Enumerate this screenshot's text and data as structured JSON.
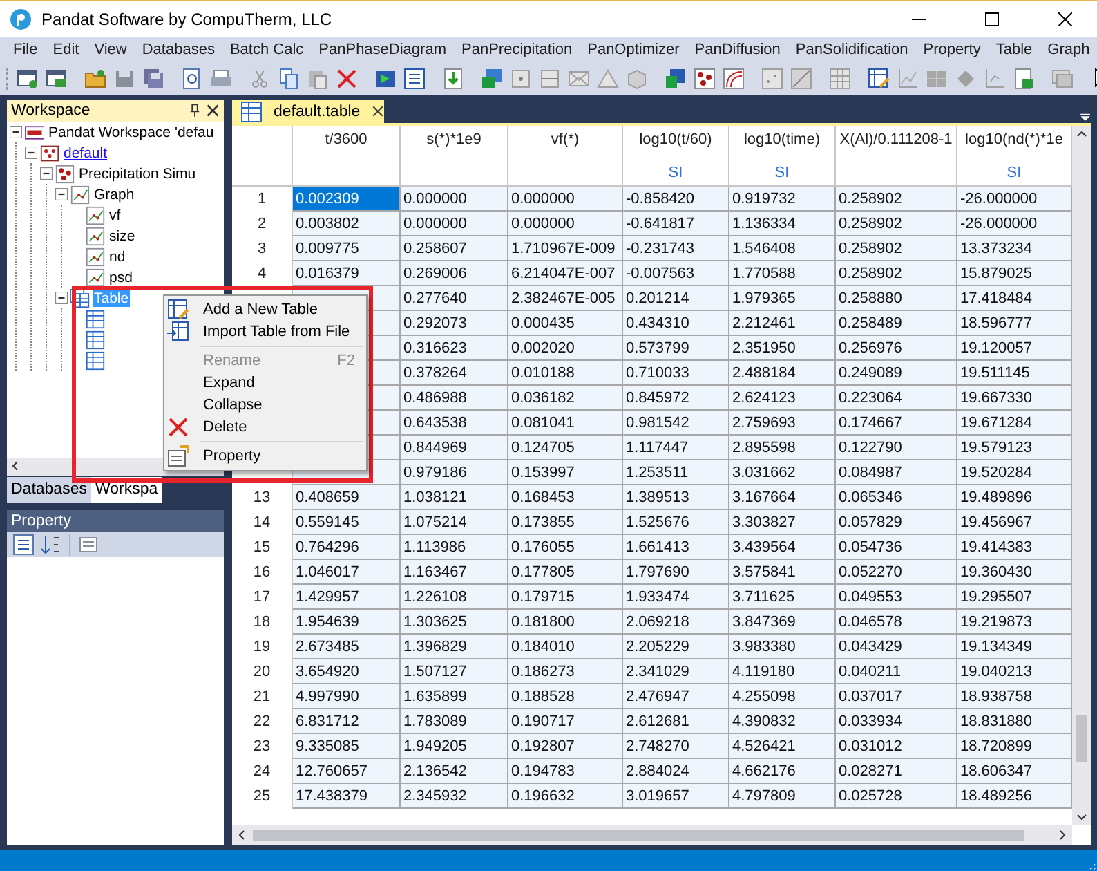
{
  "window": {
    "title": "Pandat Software by CompuTherm, LLC"
  },
  "menu_bar": [
    "File",
    "Edit",
    "View",
    "Databases",
    "Batch Calc",
    "PanPhaseDiagram",
    "PanPrecipitation",
    "PanOptimizer",
    "PanDiffusion",
    "PanSolidification",
    "Property",
    "Table",
    "Graph"
  ],
  "workspace_panel": {
    "title": "Workspace",
    "tree": [
      {
        "label": "Pandat Workspace 'defau",
        "kind": "workspace",
        "expanded": true,
        "selected": false,
        "hyperlink": false,
        "children": [
          {
            "label": "default",
            "kind": "database",
            "expanded": true,
            "selected": false,
            "hyperlink": true,
            "children": [
              {
                "label": "Precipitation Simu",
                "kind": "simulation",
                "expanded": true,
                "selected": false,
                "hyperlink": false,
                "children": [
                  {
                    "label": "Graph",
                    "kind": "graph",
                    "expanded": true,
                    "selected": false,
                    "hyperlink": false,
                    "children": [
                      {
                        "label": "vf",
                        "kind": "graph",
                        "selected": false,
                        "hyperlink": false
                      },
                      {
                        "label": "size",
                        "kind": "graph",
                        "selected": false,
                        "hyperlink": false
                      },
                      {
                        "label": "nd",
                        "kind": "graph",
                        "selected": false,
                        "hyperlink": false
                      },
                      {
                        "label": "psd",
                        "kind": "graph",
                        "selected": false,
                        "hyperlink": false
                      }
                    ]
                  },
                  {
                    "label": "Table",
                    "kind": "tables",
                    "expanded": true,
                    "selected": true,
                    "hyperlink": false,
                    "children": [
                      {
                        "kind": "table"
                      },
                      {
                        "kind": "table"
                      },
                      {
                        "kind": "table"
                      }
                    ]
                  }
                ]
              }
            ]
          }
        ]
      }
    ]
  },
  "panel_tabs": [
    {
      "label": "Databases",
      "selected": false
    },
    {
      "label": "Workspa",
      "selected": true
    }
  ],
  "property_panel": {
    "title": "Property"
  },
  "document_tabs": [
    {
      "label": "default.table",
      "selected": true
    }
  ],
  "table": {
    "columns": [
      {
        "name": "t/3600"
      },
      {
        "name": "s(*)*1e9"
      },
      {
        "name": "vf(*)"
      },
      {
        "name": "log10(t/60)",
        "unit": "SI"
      },
      {
        "name": "log10(time)",
        "unit": "SI"
      },
      {
        "name": "X(Al)/0.111208-1"
      },
      {
        "name": "log10(nd(*)*1e",
        "unit": "SI"
      }
    ],
    "rows": [
      {
        "number": "1",
        "cells": [
          {
            "text": "0.002309",
            "selected": true
          },
          {
            "text": "0.000000",
            "selected": false
          },
          {
            "text": "0.000000",
            "selected": false
          },
          {
            "text": "-0.858420",
            "selected": false
          },
          {
            "text": "0.919732",
            "selected": false
          },
          {
            "text": "0.258902",
            "selected": false
          },
          {
            "text": "-26.000000",
            "selected": false
          }
        ]
      },
      {
        "number": "2",
        "cells": [
          {
            "text": "0.003802",
            "selected": false
          },
          {
            "text": "0.000000",
            "selected": false
          },
          {
            "text": "0.000000",
            "selected": false
          },
          {
            "text": "-0.641817",
            "selected": false
          },
          {
            "text": "1.136334",
            "selected": false
          },
          {
            "text": "0.258902",
            "selected": false
          },
          {
            "text": "-26.000000",
            "selected": false
          }
        ]
      },
      {
        "number": "3",
        "cells": [
          {
            "text": "0.009775",
            "selected": false
          },
          {
            "text": "0.258607",
            "selected": false
          },
          {
            "text": "1.710967E-009",
            "selected": false
          },
          {
            "text": "-0.231743",
            "selected": false
          },
          {
            "text": "1.546408",
            "selected": false
          },
          {
            "text": "0.258902",
            "selected": false
          },
          {
            "text": "13.373234",
            "selected": false
          }
        ]
      },
      {
        "number": "4",
        "cells": [
          {
            "text": "0.016379",
            "selected": false
          },
          {
            "text": "0.269006",
            "selected": false
          },
          {
            "text": "6.214047E-007",
            "selected": false
          },
          {
            "text": "-0.007563",
            "selected": false
          },
          {
            "text": "1.770588",
            "selected": false
          },
          {
            "text": "0.258902",
            "selected": false
          },
          {
            "text": "15.879025",
            "selected": false
          }
        ]
      },
      {
        "cells": [
          {
            "selected": false
          },
          {
            "text": "0.277640",
            "selected": false
          },
          {
            "text": "2.382467E-005",
            "selected": false
          },
          {
            "text": "0.201214",
            "selected": false
          },
          {
            "text": "1.979365",
            "selected": false
          },
          {
            "text": "0.258880",
            "selected": false
          },
          {
            "text": "17.418484",
            "selected": false
          }
        ]
      },
      {
        "cells": [
          {
            "selected": false
          },
          {
            "text": "0.292073",
            "selected": false
          },
          {
            "text": "0.000435",
            "selected": false
          },
          {
            "text": "0.434310",
            "selected": false
          },
          {
            "text": "2.212461",
            "selected": false
          },
          {
            "text": "0.258489",
            "selected": false
          },
          {
            "text": "18.596777",
            "selected": false
          }
        ]
      },
      {
        "cells": [
          {
            "selected": false
          },
          {
            "text": "0.316623",
            "selected": false
          },
          {
            "text": "0.002020",
            "selected": false
          },
          {
            "text": "0.573799",
            "selected": false
          },
          {
            "text": "2.351950",
            "selected": false
          },
          {
            "text": "0.256976",
            "selected": false
          },
          {
            "text": "19.120057",
            "selected": false
          }
        ]
      },
      {
        "cells": [
          {
            "selected": false
          },
          {
            "text": "0.378264",
            "selected": false
          },
          {
            "text": "0.010188",
            "selected": false
          },
          {
            "text": "0.710033",
            "selected": false
          },
          {
            "text": "2.488184",
            "selected": false
          },
          {
            "text": "0.249089",
            "selected": false
          },
          {
            "text": "19.511145",
            "selected": false
          }
        ]
      },
      {
        "cells": [
          {
            "selected": false
          },
          {
            "text": "0.486988",
            "selected": false
          },
          {
            "text": "0.036182",
            "selected": false
          },
          {
            "text": "0.845972",
            "selected": false
          },
          {
            "text": "2.624123",
            "selected": false
          },
          {
            "text": "0.223064",
            "selected": false
          },
          {
            "text": "19.667330",
            "selected": false
          }
        ]
      },
      {
        "cells": [
          {
            "selected": false
          },
          {
            "text": "0.643538",
            "selected": false
          },
          {
            "text": "0.081041",
            "selected": false
          },
          {
            "text": "0.981542",
            "selected": false
          },
          {
            "text": "2.759693",
            "selected": false
          },
          {
            "text": "0.174667",
            "selected": false
          },
          {
            "text": "19.671284",
            "selected": false
          }
        ]
      },
      {
        "cells": [
          {
            "selected": false
          },
          {
            "text": "0.844969",
            "selected": false
          },
          {
            "text": "0.124705",
            "selected": false
          },
          {
            "text": "1.117447",
            "selected": false
          },
          {
            "text": "2.895598",
            "selected": false
          },
          {
            "text": "0.122790",
            "selected": false
          },
          {
            "text": "19.579123",
            "selected": false
          }
        ]
      },
      {
        "cells": [
          {
            "selected": false
          },
          {
            "text": "0.979186",
            "selected": false
          },
          {
            "text": "0.153997",
            "selected": false
          },
          {
            "text": "1.253511",
            "selected": false
          },
          {
            "text": "3.031662",
            "selected": false
          },
          {
            "text": "0.084987",
            "selected": false
          },
          {
            "text": "19.520284",
            "selected": false
          }
        ]
      },
      {
        "number": "13",
        "cells": [
          {
            "text": "0.408659",
            "selected": false
          },
          {
            "text": "1.038121",
            "selected": false
          },
          {
            "text": "0.168453",
            "selected": false
          },
          {
            "text": "1.389513",
            "selected": false
          },
          {
            "text": "3.167664",
            "selected": false
          },
          {
            "text": "0.065346",
            "selected": false
          },
          {
            "text": "19.489896",
            "selected": false
          }
        ]
      },
      {
        "number": "14",
        "cells": [
          {
            "text": "0.559145",
            "selected": false
          },
          {
            "text": "1.075214",
            "selected": false
          },
          {
            "text": "0.173855",
            "selected": false
          },
          {
            "text": "1.525676",
            "selected": false
          },
          {
            "text": "3.303827",
            "selected": false
          },
          {
            "text": "0.057829",
            "selected": false
          },
          {
            "text": "19.456967",
            "selected": false
          }
        ]
      },
      {
        "number": "15",
        "cells": [
          {
            "text": "0.764296",
            "selected": false
          },
          {
            "text": "1.113986",
            "selected": false
          },
          {
            "text": "0.176055",
            "selected": false
          },
          {
            "text": "1.661413",
            "selected": false
          },
          {
            "text": "3.439564",
            "selected": false
          },
          {
            "text": "0.054736",
            "selected": false
          },
          {
            "text": "19.414383",
            "selected": false
          }
        ]
      },
      {
        "number": "16",
        "cells": [
          {
            "text": "1.046017",
            "selected": false
          },
          {
            "text": "1.163467",
            "selected": false
          },
          {
            "text": "0.177805",
            "selected": false
          },
          {
            "text": "1.797690",
            "selected": false
          },
          {
            "text": "3.575841",
            "selected": false
          },
          {
            "text": "0.052270",
            "selected": false
          },
          {
            "text": "19.360430",
            "selected": false
          }
        ]
      },
      {
        "number": "17",
        "cells": [
          {
            "text": "1.429957",
            "selected": false
          },
          {
            "text": "1.226108",
            "selected": false
          },
          {
            "text": "0.179715",
            "selected": false
          },
          {
            "text": "1.933474",
            "selected": false
          },
          {
            "text": "3.711625",
            "selected": false
          },
          {
            "text": "0.049553",
            "selected": false
          },
          {
            "text": "19.295507",
            "selected": false
          }
        ]
      },
      {
        "number": "18",
        "cells": [
          {
            "text": "1.954639",
            "selected": false
          },
          {
            "text": "1.303625",
            "selected": false
          },
          {
            "text": "0.181800",
            "selected": false
          },
          {
            "text": "2.069218",
            "selected": false
          },
          {
            "text": "3.847369",
            "selected": false
          },
          {
            "text": "0.046578",
            "selected": false
          },
          {
            "text": "19.219873",
            "selected": false
          }
        ]
      },
      {
        "number": "19",
        "cells": [
          {
            "text": "2.673485",
            "selected": false
          },
          {
            "text": "1.396829",
            "selected": false
          },
          {
            "text": "0.184010",
            "selected": false
          },
          {
            "text": "2.205229",
            "selected": false
          },
          {
            "text": "3.983380",
            "selected": false
          },
          {
            "text": "0.043429",
            "selected": false
          },
          {
            "text": "19.134349",
            "selected": false
          }
        ]
      },
      {
        "number": "20",
        "cells": [
          {
            "text": "3.654920",
            "selected": false
          },
          {
            "text": "1.507127",
            "selected": false
          },
          {
            "text": "0.186273",
            "selected": false
          },
          {
            "text": "2.341029",
            "selected": false
          },
          {
            "text": "4.119180",
            "selected": false
          },
          {
            "text": "0.040211",
            "selected": false
          },
          {
            "text": "19.040213",
            "selected": false
          }
        ]
      },
      {
        "number": "21",
        "cells": [
          {
            "text": "4.997990",
            "selected": false
          },
          {
            "text": "1.635899",
            "selected": false
          },
          {
            "text": "0.188528",
            "selected": false
          },
          {
            "text": "2.476947",
            "selected": false
          },
          {
            "text": "4.255098",
            "selected": false
          },
          {
            "text": "0.037017",
            "selected": false
          },
          {
            "text": "18.938758",
            "selected": false
          }
        ]
      },
      {
        "number": "22",
        "cells": [
          {
            "text": "6.831712",
            "selected": false
          },
          {
            "text": "1.783089",
            "selected": false
          },
          {
            "text": "0.190717",
            "selected": false
          },
          {
            "text": "2.612681",
            "selected": false
          },
          {
            "text": "4.390832",
            "selected": false
          },
          {
            "text": "0.033934",
            "selected": false
          },
          {
            "text": "18.831880",
            "selected": false
          }
        ]
      },
      {
        "number": "23",
        "cells": [
          {
            "text": "9.335085",
            "selected": false
          },
          {
            "text": "1.949205",
            "selected": false
          },
          {
            "text": "0.192807",
            "selected": false
          },
          {
            "text": "2.748270",
            "selected": false
          },
          {
            "text": "4.526421",
            "selected": false
          },
          {
            "text": "0.031012",
            "selected": false
          },
          {
            "text": "18.720899",
            "selected": false
          }
        ]
      },
      {
        "number": "24",
        "cells": [
          {
            "text": "12.760657",
            "selected": false
          },
          {
            "text": "2.136542",
            "selected": false
          },
          {
            "text": "0.194783",
            "selected": false
          },
          {
            "text": "2.884024",
            "selected": false
          },
          {
            "text": "4.662176",
            "selected": false
          },
          {
            "text": "0.028271",
            "selected": false
          },
          {
            "text": "18.606347",
            "selected": false
          }
        ]
      },
      {
        "number": "25",
        "cells": [
          {
            "text": "17.438379",
            "selected": false
          },
          {
            "text": "2.345932",
            "selected": false
          },
          {
            "text": "0.196632",
            "selected": false
          },
          {
            "text": "3.019657",
            "selected": false
          },
          {
            "text": "4.797809",
            "selected": false
          },
          {
            "text": "0.025728",
            "selected": false
          },
          {
            "text": "18.489256",
            "selected": false
          }
        ]
      }
    ]
  },
  "context_menu": {
    "items": [
      {
        "kind": "item",
        "label": "Add a New Table",
        "disabled": false
      },
      {
        "kind": "item",
        "label": "Import Table from File",
        "disabled": false
      },
      {
        "kind": "separator"
      },
      {
        "kind": "item",
        "label": "Rename",
        "shortcut": "F2",
        "disabled": true
      },
      {
        "kind": "item",
        "label": "Expand",
        "disabled": false
      },
      {
        "kind": "item",
        "label": "Collapse",
        "disabled": false
      },
      {
        "kind": "item",
        "label": "Delete",
        "disabled": false
      },
      {
        "kind": "separator"
      },
      {
        "kind": "item",
        "label": "Property",
        "disabled": false
      }
    ]
  }
}
